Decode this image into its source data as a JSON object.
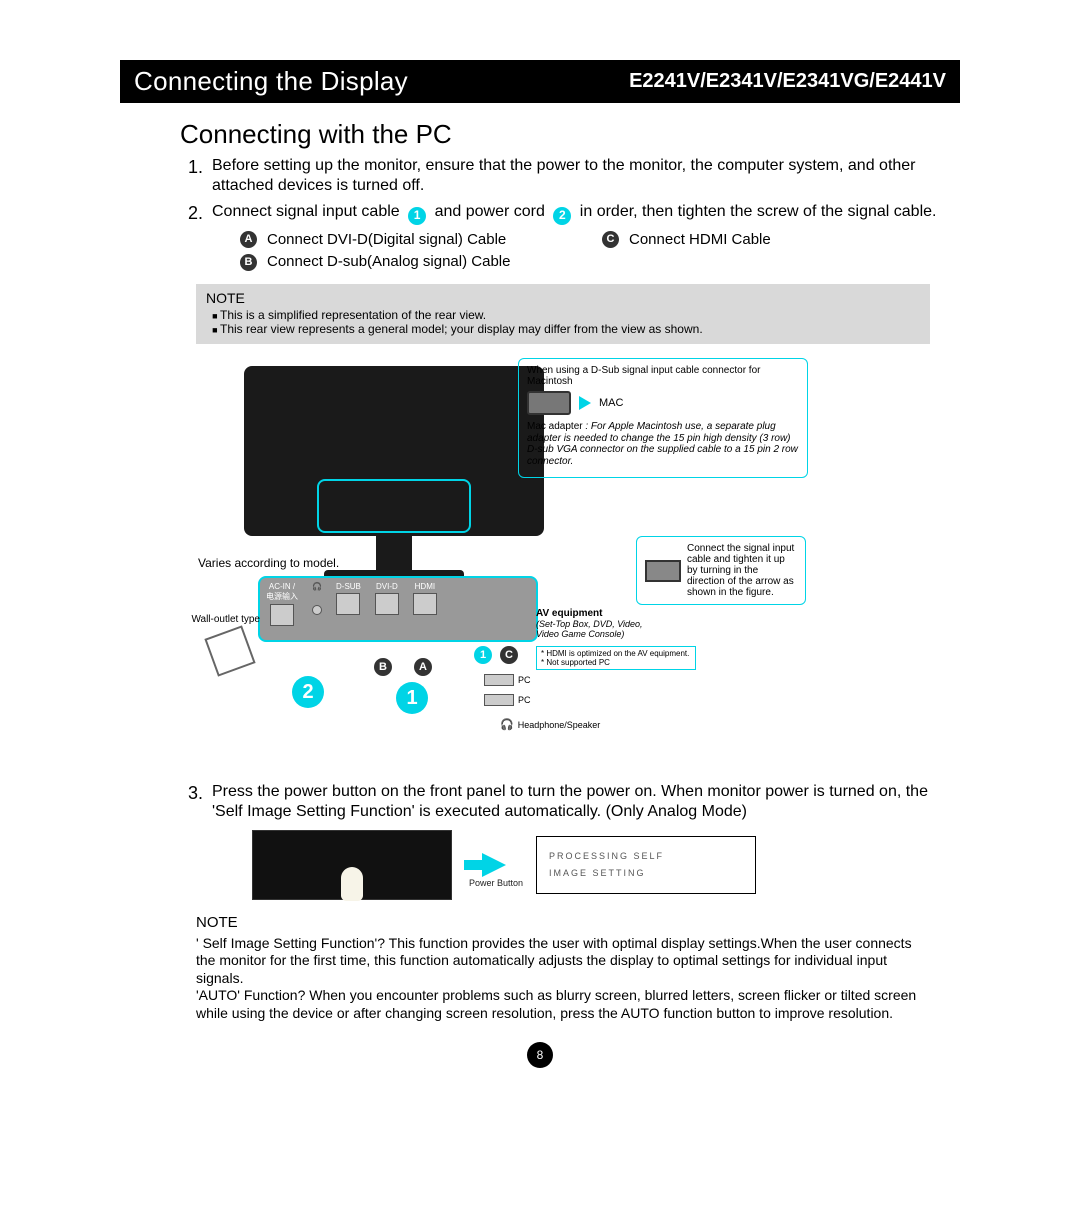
{
  "header": {
    "left": "Connecting the Display",
    "right": "E2241V/E2341V/E2341VG/E2441V"
  },
  "section_title": "Connecting with the PC",
  "steps": {
    "s1": "Before setting up the monitor, ensure that the power to the monitor, the computer system, and other attached devices is turned off.",
    "s2_a": "Connect signal input cable",
    "s2_b": "and power cord",
    "s2_c": "in order, then tighten the screw of the signal cable.",
    "s2_A": "Connect DVI-D(Digital signal) Cable",
    "s2_B": "Connect D-sub(Analog signal) Cable",
    "s2_C": "Connect HDMI Cable",
    "s3": "Press the power button on the front panel to turn the power on. When monitor power is turned on, the 'Self Image Setting Function' is executed automatically. (Only Analog Mode)"
  },
  "note1": {
    "title": "NOTE",
    "li1": "This is a simplified representation of the rear view.",
    "li2": "This rear view represents a general model; your display may differ from the view as shown."
  },
  "diagram": {
    "varies": "Varies according to model.",
    "wall_outlet": "Wall-outlet type",
    "ports": {
      "acin_a": "AC-IN /",
      "acin_b": "电源输入",
      "audio": "",
      "dsub": "D-SUB",
      "dvid": "DVI-D",
      "hdmi": "HDMI"
    },
    "av_eq_title": "AV equipment",
    "av_eq_sub": "(Set-Top Box, DVD, Video, Video Game Console)",
    "hdmi_note_a": "* HDMI is optimized on the AV equipment.",
    "hdmi_note_b": "* Not supported PC",
    "pc": "PC",
    "headphone": "Headphone/Speaker",
    "big1": "1",
    "big2": "2",
    "mA": "A",
    "mB": "B",
    "mC": "C"
  },
  "mac": {
    "head": "When using a D-Sub signal input cable connector for Macintosh",
    "label": "MAC",
    "lead": "Mac adapter",
    "desc": ": For Apple Macintosh use, a separate plug adapter is needed to change the 15 pin high density (3 row) D-sub VGA connector on the supplied cable to a 15 pin 2 row connector."
  },
  "tighten": "Connect the signal input cable and tighten it up by turning in the direction of the arrow as shown in the figure.",
  "power_button": "Power Button",
  "osd": {
    "l1": "PROCESSING SELF",
    "l2": "IMAGE SETTING"
  },
  "note2": {
    "title": "NOTE",
    "p1": "' Self Image Setting Function'? This function provides the user with optimal display settings.When the user connects the monitor for the first time, this function automatically adjusts the display to optimal settings for individual input signals.",
    "p2": "'AUTO' Function? When you encounter problems such as blurry screen, blurred letters, screen flicker or tilted screen while using the device or after changing screen resolution, press the AUTO function button to improve resolution."
  },
  "page_number": "8"
}
